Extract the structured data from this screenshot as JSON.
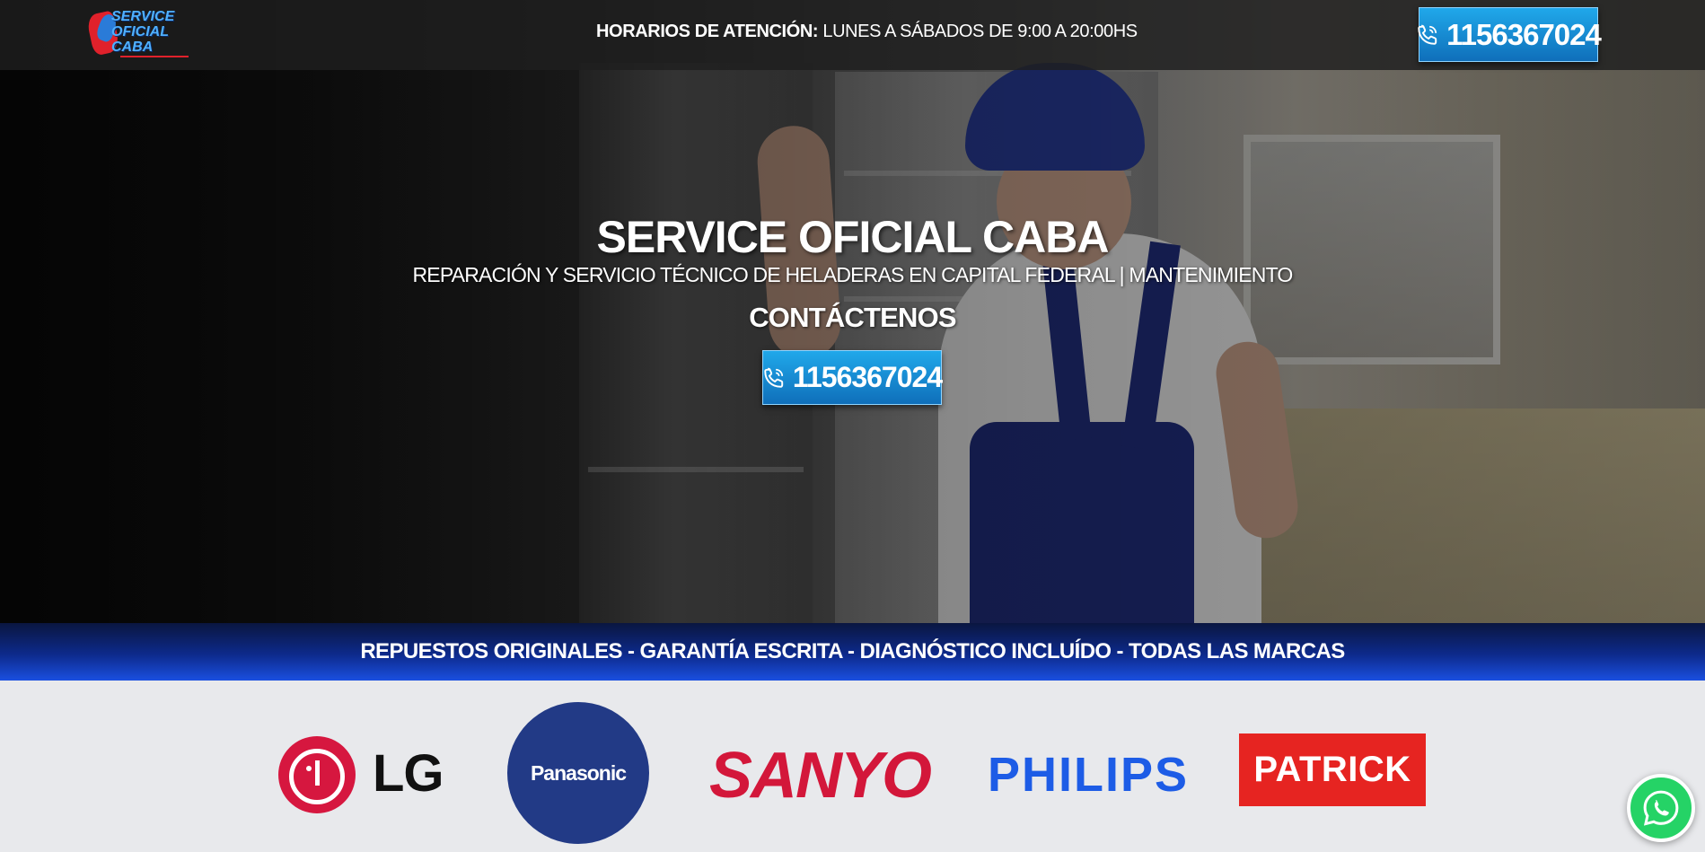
{
  "header": {
    "logo_text": [
      "SERVICE",
      "OFICIAL",
      "CABA"
    ],
    "hours_label": "HORARIOS DE ATENCIÓN:",
    "hours_value": "LUNES A SÁBADOS DE 9:00 A 20:00HS",
    "phone": "1156367024"
  },
  "hero": {
    "title": "SERVICE OFICIAL CABA",
    "subtitle": "REPARACIÓN Y SERVICIO TÉCNICO DE HELADERAS EN CAPITAL FEDERAL | MANTENIMIENTO",
    "contact_label": "CONTÁCTENOS",
    "phone": "1156367024"
  },
  "strip": {
    "text": "REPUESTOS ORIGINALES - GARANTÍA ESCRITA - DIAGNÓSTICO INCLUÍDO - TODAS LAS MARCAS"
  },
  "brands": {
    "lg": "LG",
    "panasonic": "Panasonic",
    "sanyo": "SANYO",
    "philips": "PHILIPS",
    "patrick": "PATRICK"
  },
  "icons": {
    "phone": "phone-icon",
    "whatsapp": "whatsapp-icon"
  },
  "colors": {
    "phone_button": "#1590d6",
    "strip": "#0d2a8c",
    "lg_red": "#d6173f",
    "panasonic_blue": "#223a86",
    "sanyo_red": "#d3173a",
    "philips_blue": "#1d5ce6",
    "patrick_red": "#e62421",
    "whatsapp_green": "#25d366"
  }
}
